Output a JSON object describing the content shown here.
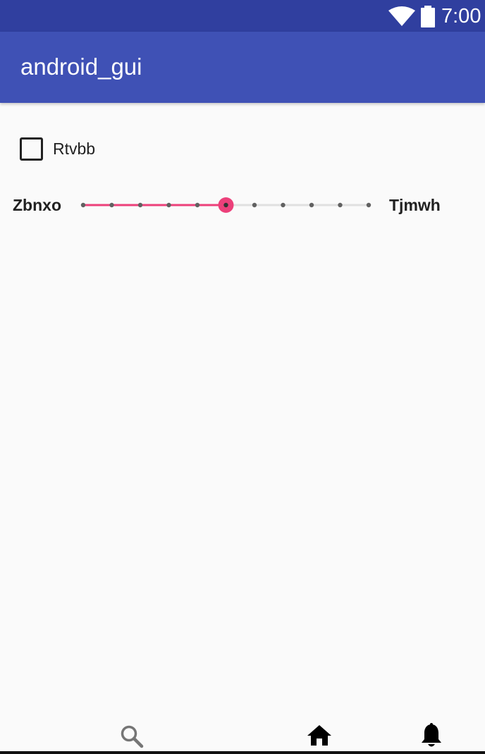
{
  "status_bar": {
    "time": "7:00",
    "icons": [
      "wifi-icon",
      "battery-icon"
    ]
  },
  "app_bar": {
    "title": "android_gui"
  },
  "checkbox": {
    "label": "Rtvbb",
    "checked": false
  },
  "seekbar": {
    "min_label": "Zbnxo",
    "max_label": "Tjmwh",
    "steps": 10,
    "value": 5,
    "accent_color": "#ec407a",
    "track_color": "#e0e0e0",
    "tick_color": "#616161"
  },
  "bottom_nav": {
    "items": [
      {
        "icon": "search-icon",
        "selected": false
      },
      {
        "icon": "home-icon",
        "selected": true
      },
      {
        "icon": "bell-icon",
        "selected": true
      }
    ]
  },
  "colors": {
    "status_bar": "#303f9f",
    "app_bar": "#3f51b5",
    "background": "#fafafa"
  }
}
